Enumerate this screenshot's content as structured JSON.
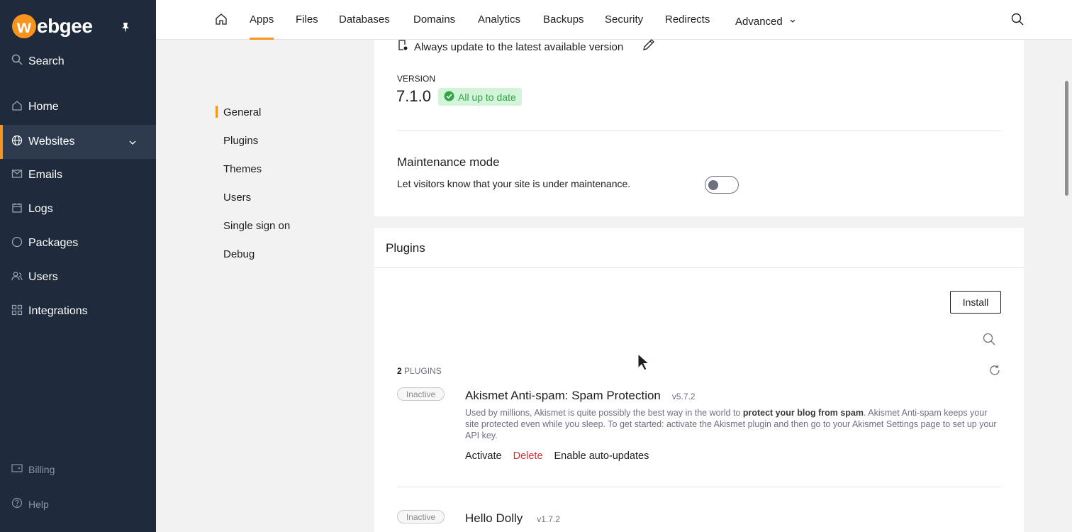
{
  "brand": {
    "logo_letter": "w",
    "logo_rest": "ebgee",
    "accent": "#f7941d"
  },
  "sidebar": {
    "search_label": "Search",
    "items": [
      {
        "label": "Home",
        "icon": "home-icon"
      },
      {
        "label": "Websites",
        "icon": "globe-icon",
        "active": true
      },
      {
        "label": "Emails",
        "icon": "mail-icon"
      },
      {
        "label": "Logs",
        "icon": "calendar-icon"
      },
      {
        "label": "Packages",
        "icon": "circle-icon"
      },
      {
        "label": "Users",
        "icon": "users-icon"
      },
      {
        "label": "Integrations",
        "icon": "grid-icon"
      }
    ],
    "footer": [
      {
        "label": "Billing",
        "icon": "wallet-icon"
      },
      {
        "label": "Help",
        "icon": "help-icon"
      }
    ]
  },
  "topnav": {
    "tabs": [
      "Apps",
      "Files",
      "Databases",
      "Domains",
      "Analytics",
      "Backups",
      "Security",
      "Redirects",
      "Advanced"
    ],
    "active_tab": "Apps"
  },
  "subnav": {
    "items": [
      "General",
      "Plugins",
      "Themes",
      "Users",
      "Single sign on",
      "Debug"
    ],
    "active": "General"
  },
  "general": {
    "update_policy": "Always update to the latest available version",
    "version_label": "VERSION",
    "version": "7.1.0",
    "version_status": "All up to date",
    "maintenance_title": "Maintenance mode",
    "maintenance_desc": "Let visitors know that your site is under maintenance.",
    "maintenance_enabled": false
  },
  "plugins": {
    "title": "Plugins",
    "install_label": "Install",
    "count_num": "2",
    "count_label": "PLUGINS",
    "list": [
      {
        "status": "Inactive",
        "name": "Akismet Anti-spam: Spam Protection",
        "version": "v5.7.2",
        "desc_pre": "Used by millions, Akismet is quite possibly the best way in the world to ",
        "desc_bold": "protect your blog from spam",
        "desc_post": ". Akismet Anti-spam keeps your site protected even while you sleep. To get started: activate the Akismet plugin and then go to your Akismet Settings page to set up your API key.",
        "actions": {
          "activate": "Activate",
          "delete": "Delete",
          "auto": "Enable auto-updates"
        }
      },
      {
        "status": "Inactive",
        "name": "Hello Dolly",
        "version": "v1.7.2"
      }
    ]
  }
}
